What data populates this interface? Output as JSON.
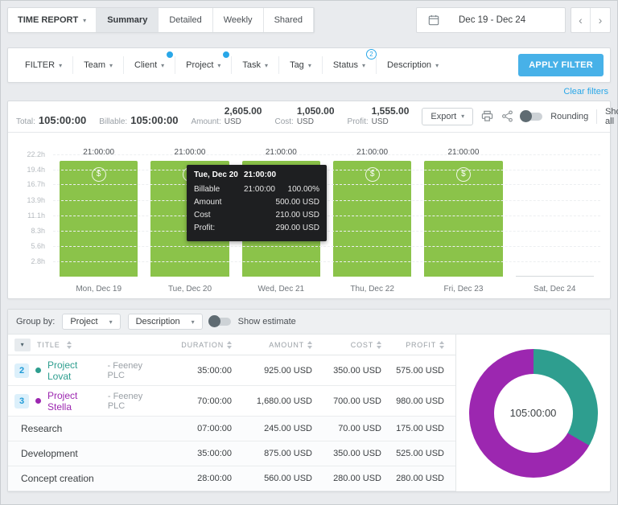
{
  "header": {
    "report_menu": "TIME REPORT",
    "tabs": [
      "Summary",
      "Detailed",
      "Weekly",
      "Shared"
    ],
    "active_tab": "Summary",
    "date_range": "Dec 19 - Dec 24",
    "prev_label": "‹",
    "next_label": "›"
  },
  "filters": {
    "items": [
      {
        "label": "FILTER",
        "badge": ""
      },
      {
        "label": "Team",
        "badge": ""
      },
      {
        "label": "Client",
        "badge": "dot"
      },
      {
        "label": "Project",
        "badge": "dot"
      },
      {
        "label": "Task",
        "badge": ""
      },
      {
        "label": "Tag",
        "badge": ""
      },
      {
        "label": "Status",
        "badge": "2"
      },
      {
        "label": "Description",
        "badge": ""
      }
    ],
    "apply_label": "APPLY FILTER",
    "clear_label": "Clear filters"
  },
  "summary": {
    "total_label": "Total:",
    "total_value": "105:00:00",
    "billable_label": "Billable:",
    "billable_value": "105:00:00",
    "amount_label": "Amount:",
    "amount_value": "2,605.00",
    "amount_currency": "USD",
    "cost_label": "Cost:",
    "cost_value": "1,050.00",
    "cost_currency": "USD",
    "profit_label": "Profit:",
    "profit_value": "1,555.00",
    "profit_currency": "USD",
    "export_label": "Export",
    "rounding_label": "Rounding",
    "show_all_label": "Show all"
  },
  "chart_data": {
    "type": "bar",
    "categories": [
      "Mon, Dec 19",
      "Tue, Dec 20",
      "Wed, Dec 21",
      "Thu, Dec 22",
      "Fri, Dec 23",
      "Sat, Dec 24"
    ],
    "values_hours": [
      21,
      21,
      21,
      21,
      21,
      0
    ],
    "bar_labels": [
      "21:00:00",
      "21:00:00",
      "21:00:00",
      "21:00:00",
      "21:00:00",
      ""
    ],
    "y_ticks": [
      "22.2h",
      "19.4h",
      "16.7h",
      "13.9h",
      "11.1h",
      "8.3h",
      "5.6h",
      "2.8h"
    ],
    "ylim_hours": [
      0,
      24
    ],
    "bar_color": "#8bc34a",
    "grid": "dashed",
    "legend": "none"
  },
  "tooltip": {
    "date": "Tue, Dec 20",
    "time": "21:00:00",
    "rows": [
      {
        "label": "Billable",
        "mid": "21:00:00",
        "value": "100.00%"
      },
      {
        "label": "Amount",
        "mid": "",
        "value": "500.00 USD"
      },
      {
        "label": "Cost",
        "mid": "",
        "value": "210.00 USD"
      },
      {
        "label": "Profit:",
        "mid": "",
        "value": "290.00 USD"
      }
    ]
  },
  "groupbar": {
    "label": "Group by:",
    "selects": [
      "Project",
      "Description"
    ],
    "estimate_label": "Show estimate"
  },
  "table": {
    "columns": [
      "TITLE",
      "DURATION",
      "AMOUNT",
      "COST",
      "PROFIT"
    ],
    "rows": [
      {
        "type": "project",
        "count": "2",
        "bullet_color": "#2e9e8f",
        "title": "Project Lovat",
        "title_color": "#2e9e8f",
        "subtitle": "- Feeney PLC",
        "duration": "35:00:00",
        "amount": "925.00 USD",
        "cost": "350.00 USD",
        "profit": "575.00 USD"
      },
      {
        "type": "project",
        "count": "3",
        "bullet_color": "#9c27b0",
        "title": "Project Stella",
        "title_color": "#9c27b0",
        "subtitle": "- Feeney PLC",
        "duration": "70:00:00",
        "amount": "1,680.00 USD",
        "cost": "700.00 USD",
        "profit": "980.00 USD"
      },
      {
        "type": "group",
        "title": "Research",
        "duration": "07:00:00",
        "amount": "245.00 USD",
        "cost": "70.00 USD",
        "profit": "175.00 USD"
      },
      {
        "type": "group",
        "title": "Development",
        "duration": "35:00:00",
        "amount": "875.00 USD",
        "cost": "350.00 USD",
        "profit": "525.00 USD"
      },
      {
        "type": "group",
        "title": "Concept creation",
        "duration": "28:00:00",
        "amount": "560.00 USD",
        "cost": "280.00 USD",
        "profit": "280.00 USD"
      }
    ]
  },
  "donut": {
    "type": "pie",
    "center_label": "105:00:00",
    "slices": [
      {
        "name": "Project Lovat",
        "duration": "35:00:00",
        "fraction": 0.3333,
        "color": "#2e9e8f"
      },
      {
        "name": "Project Stella",
        "duration": "70:00:00",
        "fraction": 0.6667,
        "color": "#9c27b0"
      }
    ]
  },
  "colors": {
    "accent_blue": "#29a7e8",
    "apply_button": "#47b1e8",
    "bar_green": "#8bc34a",
    "teal": "#2e9e8f",
    "purple": "#9c27b0",
    "tooltip_bg": "#1e1f21"
  }
}
